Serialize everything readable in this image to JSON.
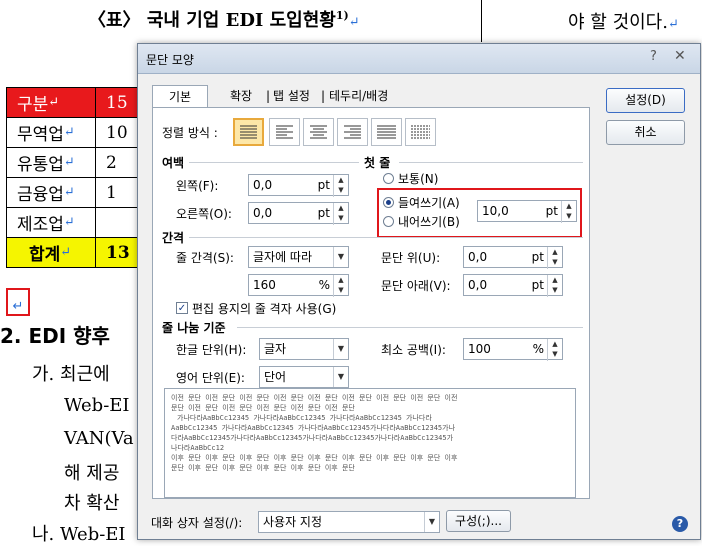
{
  "document": {
    "heading": "〈표〉 국내 기업 EDI 도입현황",
    "heading_sup": "1)",
    "paragraph_mark": "↵",
    "right_text": "야 할 것이다.",
    "table": {
      "header": [
        "구분",
        "15"
      ],
      "rows": [
        [
          "무역업",
          "10"
        ],
        [
          "유통업",
          "2"
        ],
        [
          "금융업",
          "1"
        ],
        [
          "제조업",
          ""
        ]
      ],
      "total": [
        "합계",
        "13"
      ]
    },
    "section_title": "2. EDI 향후",
    "lines": [
      "가. 최근에",
      "Web-EI",
      "VAN(Va",
      "해 제공",
      "차 확산",
      "나. Web-EI"
    ]
  },
  "dialog": {
    "title": "문단 모양",
    "help_glyph": "?",
    "close_glyph": "✕",
    "tabs": [
      "기본",
      "확장",
      "탭 설정",
      "테두리/배경"
    ],
    "buttons": {
      "ok": "설정(D)",
      "cancel": "취소",
      "composition": "구성(;)..."
    },
    "alignment_label": "정렬 방식 :",
    "margin": {
      "section": "여백",
      "left_label": "왼쪽(F):",
      "left_value": "0,0",
      "left_unit": "pt",
      "right_label": "오른쪽(O):",
      "right_value": "0,0",
      "right_unit": "pt"
    },
    "first_line": {
      "section": "첫 줄",
      "normal": "보통(N)",
      "indent": "들여쓰기(A)",
      "outdent": "내어쓰기(B)",
      "value": "10,0",
      "unit": "pt",
      "selected": "indent"
    },
    "spacing": {
      "section": "간격",
      "line_spacing_label": "줄 간격(S):",
      "line_spacing_type": "글자에 따라",
      "line_spacing_value": "160",
      "line_spacing_unit": "%",
      "above_label": "문단 위(U):",
      "above_value": "0,0",
      "above_unit": "pt",
      "below_label": "문단 아래(V):",
      "below_value": "0,0",
      "below_unit": "pt",
      "grid_checkbox": "편집 용지의 줄 격자 사용(G)",
      "grid_checked": true
    },
    "line_break": {
      "section": "줄 나눔 기준",
      "hangul_label": "한글 단위(H):",
      "hangul_value": "글자",
      "english_label": "영어 단위(E):",
      "english_value": "단어",
      "min_space_label": "최소 공백(I):",
      "min_space_value": "100",
      "min_space_unit": "%"
    },
    "preview_lines": [
      "이전 문단 이전 문단 이전 문단 이전 문단 이전 문단 이전 문단 이전 문단 이전 문단 이전",
      "문단 이전 문단 이전 문단 이전 문단 이전 문단 이전 문단",
      "가나다라AaBbCc12345   가나다라AaBbCc12345   가나다라AaBbCc12345   가나다라",
      "AaBbCc12345 가나다라AaBbCc12345 가나다라AaBbCc12345가나다라AaBbCc12345가나",
      "다라AaBbCc12345가나다라AaBbCc12345가나다라AaBbCc12345가나다라AaBbCc12345가",
      "나다라AaBbCc12",
      "이후 문단 이후 문단 이후 문단 이후 문단 이후 문단 이후 문단 이후 문단 이후 문단 이후",
      "문단 이후 문단 이후 문단 이후 문단 이후 문단 이후 문단"
    ],
    "dialog_setting_label": "대화 상자 설정(/):",
    "dialog_setting_value": "사용자 지정",
    "help_icon_glyph": "?"
  }
}
